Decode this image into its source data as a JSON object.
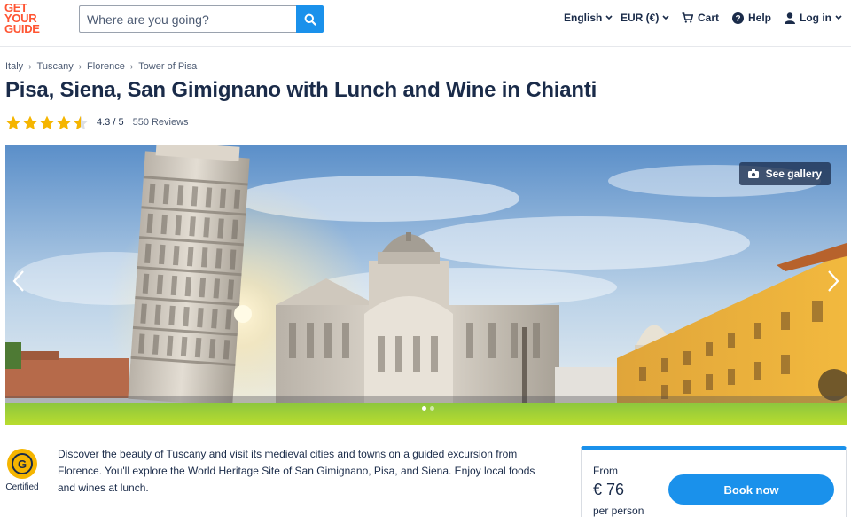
{
  "header": {
    "logo_lines": [
      "GET",
      "YOUR",
      "GUIDE"
    ],
    "search_placeholder": "Where are you going?",
    "nav": {
      "language": "English",
      "currency": "EUR (€)",
      "cart": "Cart",
      "help": "Help",
      "login": "Log in"
    }
  },
  "breadcrumb": [
    "Italy",
    "Tuscany",
    "Florence",
    "Tower of Pisa"
  ],
  "title": "Pisa, Siena, San Gimignano with Lunch and Wine in Chianti",
  "rating": {
    "stars": 4.3,
    "value_text": "4.3 / 5",
    "reviews_text": "550 Reviews"
  },
  "hero": {
    "gallery_label": "See gallery",
    "dot_count": 2,
    "active_dot": 0
  },
  "badge": {
    "letter": "G",
    "label": "Certified"
  },
  "description": "Discover the beauty of Tuscany and visit its medieval cities and towns on a guided excursion from Florence. You'll explore the World Heritage Site of San Gimignano, Pisa, and Siena. Enjoy local foods and wines at lunch.",
  "booking": {
    "from_label": "From",
    "price": "€ 76",
    "per_label": "per person",
    "book_label": "Book now"
  },
  "colors": {
    "brand": "#ff5533",
    "accent": "#1a91eb",
    "text": "#1a2b49",
    "star": "#f5b500"
  }
}
